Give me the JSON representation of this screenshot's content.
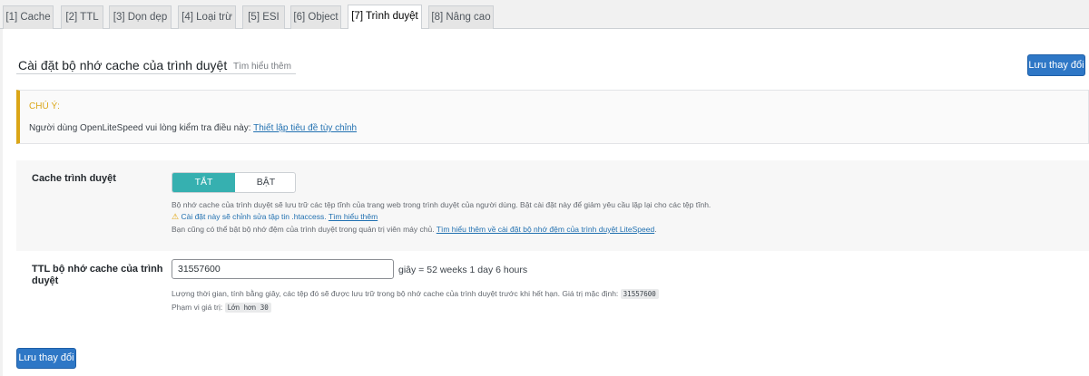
{
  "tabs": [
    {
      "label": "[1] Cache",
      "active": false
    },
    {
      "label": "[2] TTL",
      "active": false
    },
    {
      "label": "[3] Dọn dẹp",
      "active": false
    },
    {
      "label": "[4] Loại trừ",
      "active": false
    },
    {
      "label": "[5] ESI",
      "active": false
    },
    {
      "label": "[6] Object",
      "active": false
    },
    {
      "label": "[7] Trình duyệt",
      "active": true
    },
    {
      "label": "[8] Nâng cao",
      "active": false
    }
  ],
  "header": {
    "title": "Cài đặt bộ nhớ cache của trình duyệt",
    "learn_more": "Tìm hiểu thêm",
    "save_label": "Lưu thay đổi"
  },
  "notice": {
    "title": "CHÚ Ý:",
    "text": "Người dùng OpenLiteSpeed vui lòng kiểm tra điều này: ",
    "link": "Thiết lập tiêu đề tùy chỉnh",
    "accent_color": "#dba617"
  },
  "browser_cache": {
    "label": "Cache trình duyệt",
    "toggle_off": "TẮT",
    "toggle_on": "BẬT",
    "selected": "TẮT",
    "desc1": "Bộ nhớ cache của trình duyệt sẽ lưu trữ các tệp tĩnh của trang web trong trình duyệt của người dùng. Bật cài đặt này để giảm yêu cầu lặp lại cho các tệp tĩnh.",
    "warning_icon": "warning-icon",
    "warning_text": "Cài đặt này sẽ chỉnh sửa tập tin .htaccess.",
    "warning_link": "Tìm hiểu thêm",
    "desc3": "Bạn cũng có thể bật bộ nhớ đệm của trình duyệt trong quản trị viên máy chủ.",
    "desc3_link": "Tìm hiểu thêm về cài đặt bộ nhớ đệm của trình duyệt LiteSpeed",
    "desc3_end": ".",
    "toggle_color": "#36b0b0"
  },
  "ttl": {
    "label_line1": "TTL bộ nhớ cache của trình",
    "label_line2": "duyệt",
    "value": "31557600",
    "unit_text": "giây = 52 weeks 1 day 6 hours",
    "desc": "Lượng thời gian, tính bằng giây, các tệp đó sẽ được lưu trữ trong bộ nhớ cache của trình duyệt trước khi hết hạn. Giá trị mặc định:",
    "default_value": "31557600",
    "range_label": "Phạm vi giá trị:",
    "range_value": "Lớn hơn 30"
  },
  "footer": {
    "save_label": "Lưu thay đổi"
  },
  "colors": {
    "primary_button": "#2e77c6",
    "link": "#2271b1"
  }
}
